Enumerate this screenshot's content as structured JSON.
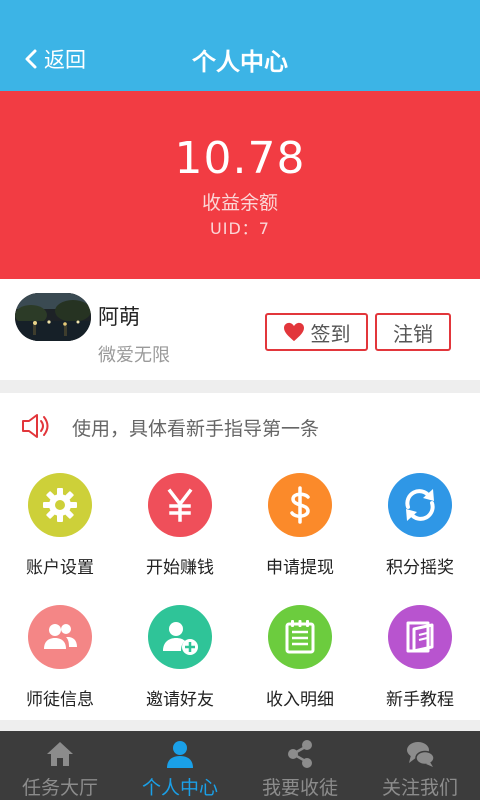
{
  "header": {
    "back_label": "返回",
    "title": "个人中心"
  },
  "balance": {
    "amount": "10.78",
    "label": "收益余额",
    "uid": "UID：7"
  },
  "profile": {
    "nickname": "阿萌",
    "slogan": "微爱无限",
    "sign_label": "签到",
    "logout_label": "注销"
  },
  "notice": {
    "text": "使用，具体看新手指导第一条"
  },
  "grid": [
    {
      "label": "账户设置",
      "icon": "gear-icon",
      "color": "#cdd039"
    },
    {
      "label": "开始赚钱",
      "icon": "yen-icon",
      "color": "#ef4f5a"
    },
    {
      "label": "申请提现",
      "icon": "dollar-icon",
      "color": "#fb8a2a"
    },
    {
      "label": "积分摇奖",
      "icon": "refresh-icon",
      "color": "#2f97e6"
    },
    {
      "label": "师徒信息",
      "icon": "users-icon",
      "color": "#f48686"
    },
    {
      "label": "邀请好友",
      "icon": "add-user-icon",
      "color": "#2fc498"
    },
    {
      "label": "收入明细",
      "icon": "notebook-icon",
      "color": "#6ccc3e"
    },
    {
      "label": "新手教程",
      "icon": "book-icon",
      "color": "#b854cf"
    }
  ],
  "tabs": [
    {
      "label": "任务大厅",
      "icon": "home-icon",
      "active": false
    },
    {
      "label": "个人中心",
      "icon": "person-icon",
      "active": true
    },
    {
      "label": "我要收徒",
      "icon": "share-icon",
      "active": false
    },
    {
      "label": "关注我们",
      "icon": "chat-icon",
      "active": false
    }
  ],
  "colors": {
    "header": "#3cb4e6",
    "balance_bg": "#f23c43",
    "accent_red": "#e2363b",
    "tab_active": "#1aa0e8",
    "tabbar_bg": "#3c3c3c"
  }
}
